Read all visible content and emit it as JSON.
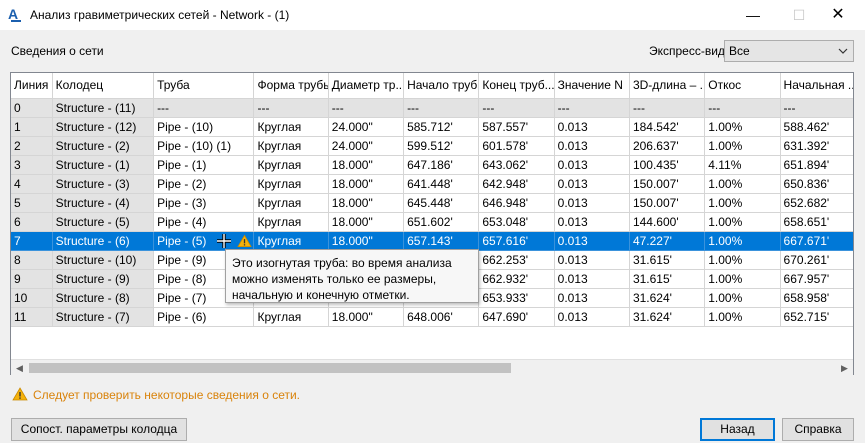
{
  "window": {
    "title": "Анализ гравиметрических сетей - Network - (1)",
    "min_glyph": "—",
    "max_glyph": "☐",
    "close_glyph": "✕"
  },
  "labels": {
    "network_info": "Сведения о сети",
    "express_view": "Экспресс-вид"
  },
  "express_select": {
    "value": "Все"
  },
  "grid": {
    "columns": [
      "Линия",
      "Колодец",
      "Труба",
      "Форма трубы",
      "Диаметр тр...",
      "Начало труб...",
      "Конец труб...",
      "Значение N",
      "3D-длина – ...",
      "Откос",
      "Начальная ..."
    ],
    "rows": [
      [
        "0",
        "Structure - (11)",
        "---",
        "---",
        "---",
        "---",
        "---",
        "---",
        "---",
        "---",
        "---"
      ],
      [
        "1",
        "Structure - (12)",
        "Pipe - (10)",
        "Круглая",
        "24.000\"",
        "585.712'",
        "587.557'",
        "0.013",
        "184.542'",
        "1.00%",
        "588.462'"
      ],
      [
        "2",
        "Structure - (2)",
        "Pipe - (10) (1)",
        "Круглая",
        "24.000\"",
        "599.512'",
        "601.578'",
        "0.013",
        "206.637'",
        "1.00%",
        "631.392'"
      ],
      [
        "3",
        "Structure - (1)",
        "Pipe - (1)",
        "Круглая",
        "18.000\"",
        "647.186'",
        "643.062'",
        "0.013",
        "100.435'",
        "4.11%",
        "651.894'"
      ],
      [
        "4",
        "Structure - (3)",
        "Pipe - (2)",
        "Круглая",
        "18.000\"",
        "641.448'",
        "642.948'",
        "0.013",
        "150.007'",
        "1.00%",
        "650.836'"
      ],
      [
        "5",
        "Structure - (4)",
        "Pipe - (3)",
        "Круглая",
        "18.000\"",
        "645.448'",
        "646.948'",
        "0.013",
        "150.007'",
        "1.00%",
        "652.682'"
      ],
      [
        "6",
        "Structure - (5)",
        "Pipe - (4)",
        "Круглая",
        "18.000\"",
        "651.602'",
        "653.048'",
        "0.013",
        "144.600'",
        "1.00%",
        "658.651'"
      ],
      [
        "7",
        "Structure - (6)",
        "Pipe - (5)",
        "Круглая",
        "18.000\"",
        "657.143'",
        "657.616'",
        "0.013",
        "47.227'",
        "1.00%",
        "667.671'"
      ],
      [
        "8",
        "Structure - (10)",
        "Pipe - (9)",
        "",
        "",
        "",
        "662.253'",
        "0.013",
        "31.615'",
        "1.00%",
        "670.261'"
      ],
      [
        "9",
        "Structure - (9)",
        "Pipe - (8)",
        "",
        "",
        "",
        "662.932'",
        "0.013",
        "31.615'",
        "1.00%",
        "667.957'"
      ],
      [
        "10",
        "Structure - (8)",
        "Pipe - (7)",
        "",
        "",
        "",
        "653.933'",
        "0.013",
        "31.624'",
        "1.00%",
        "658.958'"
      ],
      [
        "11",
        "Structure - (7)",
        "Pipe - (6)",
        "Круглая",
        "18.000\"",
        "648.006'",
        "647.690'",
        "0.013",
        "31.624'",
        "1.00%",
        "652.715'"
      ]
    ],
    "selected_row": 7,
    "cursor_icon": "move-cursor-icon",
    "warning_icon": "warning-icon"
  },
  "tooltip": {
    "text": "Это изогнутая труба: во время анализа\nможно изменять только ее размеры,\nначальную и конечную отметки."
  },
  "scrollbar": {
    "left_glyph": "◀",
    "right_glyph": "▶"
  },
  "warning": {
    "icon": "warning-icon",
    "text": "Следует проверить некоторые сведения о сети.",
    "color": "#d9830b"
  },
  "buttons": {
    "structure_params": "Сопост. параметры колодца",
    "back": "Назад",
    "help": "Справка"
  },
  "colors": {
    "selection": "#0078d7",
    "readonly_cell": "#e3e3e3",
    "accent": "#0078d7"
  }
}
